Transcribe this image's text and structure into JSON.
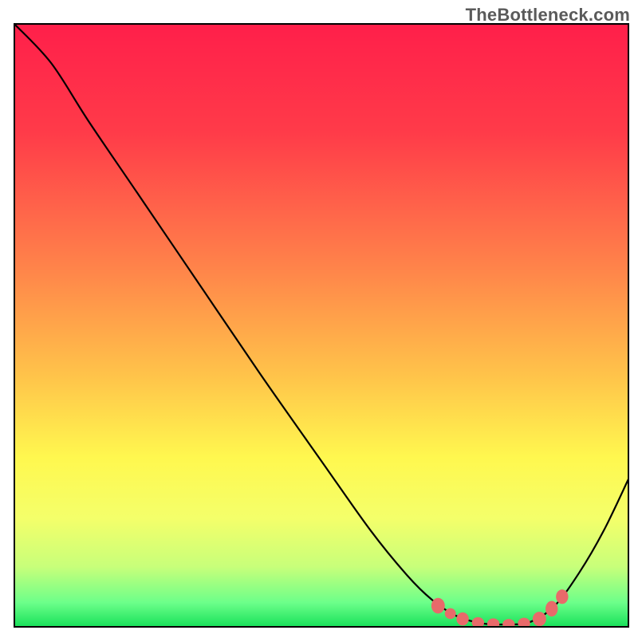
{
  "watermark": "TheBottleneck.com",
  "colors": {
    "gradient_stops": [
      {
        "offset": 0.0,
        "color": "#ff1f4a"
      },
      {
        "offset": 0.18,
        "color": "#ff3b49"
      },
      {
        "offset": 0.4,
        "color": "#ff824a"
      },
      {
        "offset": 0.58,
        "color": "#ffc24a"
      },
      {
        "offset": 0.72,
        "color": "#fff84f"
      },
      {
        "offset": 0.82,
        "color": "#f4ff6a"
      },
      {
        "offset": 0.9,
        "color": "#c8ff7a"
      },
      {
        "offset": 0.96,
        "color": "#6cff8a"
      },
      {
        "offset": 1.0,
        "color": "#18e05a"
      }
    ],
    "curve": "#000000",
    "markers": "#e86a6a",
    "frame": "#000000"
  },
  "chart_data": {
    "type": "line",
    "title": "",
    "xlabel": "",
    "ylabel": "",
    "xlim": [
      0,
      100
    ],
    "ylim": [
      0,
      100
    ],
    "grid": false,
    "curve_normalized": [
      {
        "x": 0.0,
        "y": 1.0
      },
      {
        "x": 0.06,
        "y": 0.935
      },
      {
        "x": 0.12,
        "y": 0.84
      },
      {
        "x": 0.2,
        "y": 0.72
      },
      {
        "x": 0.3,
        "y": 0.57
      },
      {
        "x": 0.4,
        "y": 0.42
      },
      {
        "x": 0.5,
        "y": 0.275
      },
      {
        "x": 0.58,
        "y": 0.16
      },
      {
        "x": 0.64,
        "y": 0.085
      },
      {
        "x": 0.68,
        "y": 0.045
      },
      {
        "x": 0.72,
        "y": 0.018
      },
      {
        "x": 0.76,
        "y": 0.006
      },
      {
        "x": 0.8,
        "y": 0.004
      },
      {
        "x": 0.84,
        "y": 0.008
      },
      {
        "x": 0.88,
        "y": 0.035
      },
      {
        "x": 0.92,
        "y": 0.09
      },
      {
        "x": 0.96,
        "y": 0.16
      },
      {
        "x": 1.0,
        "y": 0.245
      }
    ],
    "markers_normalized": [
      {
        "x": 0.69,
        "y": 0.035,
        "rx": 0.011,
        "ry": 0.013
      },
      {
        "x": 0.71,
        "y": 0.022,
        "rx": 0.009,
        "ry": 0.009
      },
      {
        "x": 0.73,
        "y": 0.013,
        "rx": 0.01,
        "ry": 0.011
      },
      {
        "x": 0.755,
        "y": 0.007,
        "rx": 0.01,
        "ry": 0.009
      },
      {
        "x": 0.78,
        "y": 0.005,
        "rx": 0.01,
        "ry": 0.009
      },
      {
        "x": 0.805,
        "y": 0.004,
        "rx": 0.01,
        "ry": 0.009
      },
      {
        "x": 0.83,
        "y": 0.006,
        "rx": 0.01,
        "ry": 0.009
      },
      {
        "x": 0.855,
        "y": 0.013,
        "rx": 0.011,
        "ry": 0.012
      },
      {
        "x": 0.875,
        "y": 0.03,
        "rx": 0.01,
        "ry": 0.013
      },
      {
        "x": 0.892,
        "y": 0.05,
        "rx": 0.01,
        "ry": 0.012
      }
    ],
    "annotations": []
  }
}
